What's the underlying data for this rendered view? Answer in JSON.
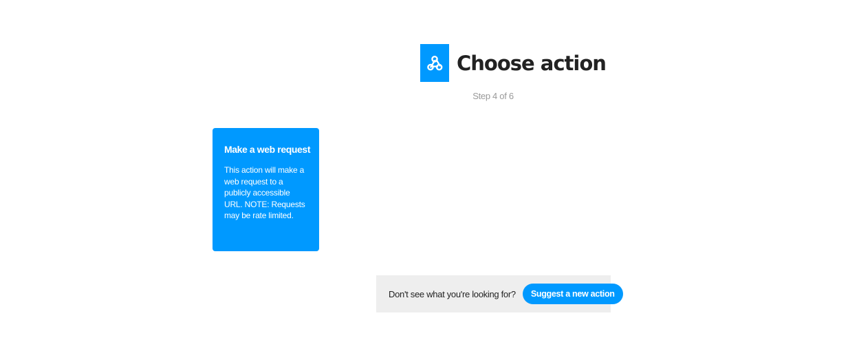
{
  "header": {
    "logo_icon": "webhooks-icon",
    "title": "Choose action",
    "step": "Step 4 of 6"
  },
  "actions": [
    {
      "title": "Make a web request",
      "description": "This action will make a web request to a publicly accessible URL. NOTE: Requests may be rate limited."
    }
  ],
  "suggest": {
    "prompt": "Don't see what you're looking for?",
    "button_label": "Suggest a new action"
  },
  "colors": {
    "accent": "#0099ff",
    "title_text": "#222222",
    "muted_text": "#999999",
    "suggest_bar_bg": "#eeeeee"
  }
}
